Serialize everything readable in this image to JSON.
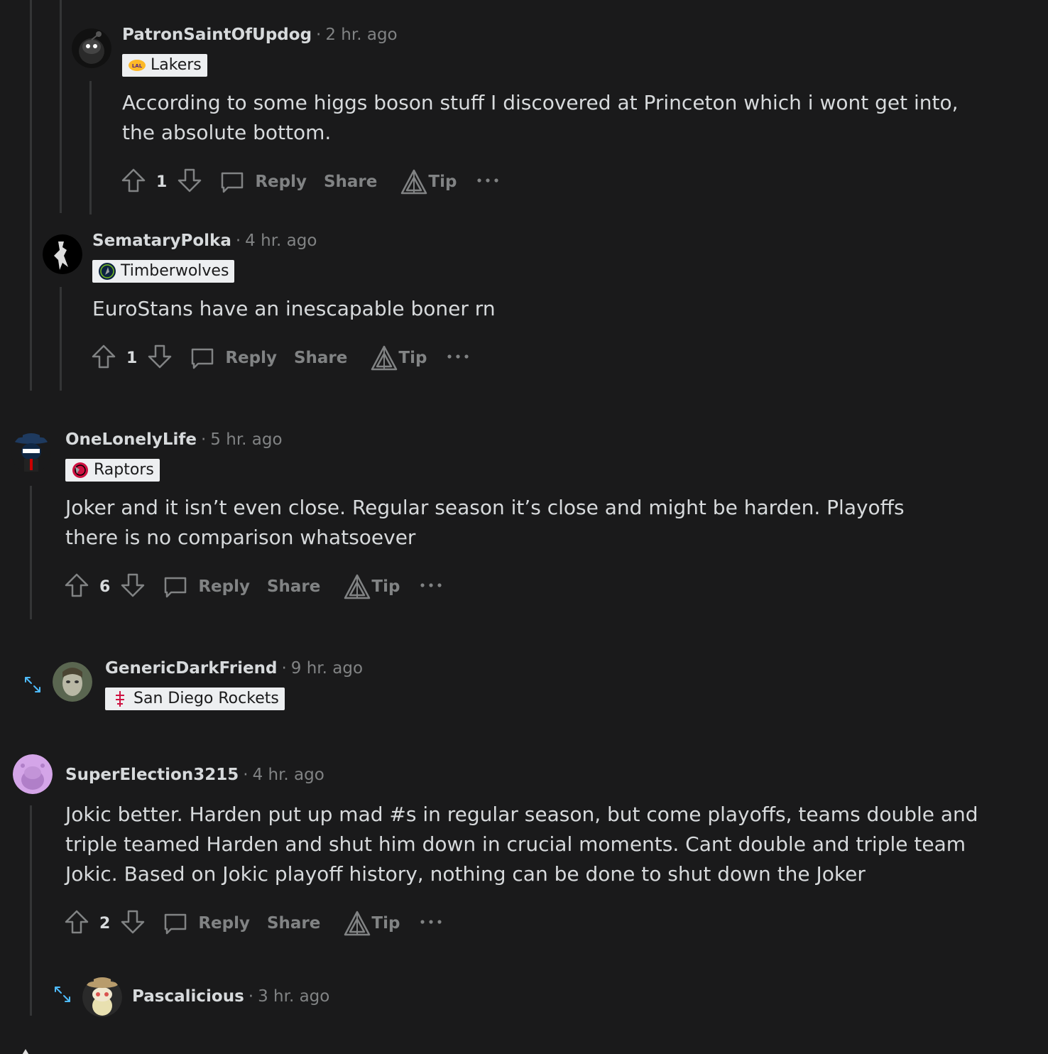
{
  "comments": [
    {
      "username": "PatronSaintOfUpdog",
      "time": "2 hr. ago",
      "flair": "Lakers",
      "body": "According to some higgs boson stuff I discovered at Princeton which i wont get into, the absolute bottom.",
      "votes": "1"
    },
    {
      "username": "SemataryPolka",
      "time": "4 hr. ago",
      "flair": "Timberwolves",
      "body": "EuroStans have an inescapable boner rn",
      "votes": "1"
    },
    {
      "username": "OneLonelyLife",
      "time": "5 hr. ago",
      "flair": "Raptors",
      "body": "Joker and it isn’t even close. Regular season it’s close and might be harden. Playoffs there is no comparison whatsoever",
      "votes": "6"
    },
    {
      "username": "GenericDarkFriend",
      "time": "9 hr. ago",
      "flair": "San Diego Rockets"
    },
    {
      "username": "SuperElection3215",
      "time": "4 hr. ago",
      "body": "Jokic better. Harden put up mad #s in regular season, but come playoffs, teams double and triple teamed Harden and shut him down in crucial moments. Cant double and triple team Jokic. Based on Jokic playoff history, nothing can be done to shut down the Joker",
      "votes": "2"
    },
    {
      "username": "Pascalicious",
      "time": "3 hr. ago"
    }
  ],
  "actions": {
    "reply": "Reply",
    "share": "Share",
    "tip": "Tip"
  },
  "colors": {
    "background": "#1a1a1b",
    "text": "#d7dadc",
    "muted": "#818384",
    "thread_line": "#343536",
    "flair_bg": "#edeff1",
    "expand_icon": "#4fbcff"
  },
  "icons": [
    "upvote-icon",
    "downvote-icon",
    "comment-icon",
    "tip-icon",
    "more-icon",
    "expand-icon"
  ]
}
